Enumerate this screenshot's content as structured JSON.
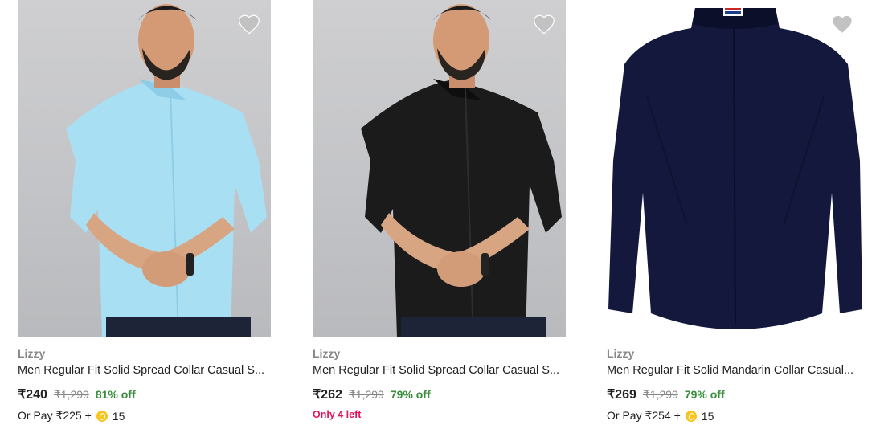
{
  "products": [
    {
      "brand": "Lizzy",
      "title": "Men Regular Fit Solid Spread Collar Casual S...",
      "price": "₹240",
      "mrp": "₹1,299",
      "discount": "81% off",
      "extra_prefix": "Or Pay ₹225 +",
      "extra_coins": "15",
      "shirt_color": "#a9dff3",
      "image_icon": "model-light-blue-shirt"
    },
    {
      "brand": "Lizzy",
      "title": "Men Regular Fit Solid Spread Collar Casual S...",
      "price": "₹262",
      "mrp": "₹1,299",
      "discount": "79% off",
      "stock_note": "Only 4 left",
      "shirt_color": "#1b1b1c",
      "image_icon": "model-black-shirt"
    },
    {
      "brand": "Lizzy",
      "title": "Men Regular Fit Solid Mandarin Collar Casual...",
      "price": "₹269",
      "mrp": "₹1,299",
      "discount": "79% off",
      "extra_prefix": "Or Pay ₹254 +",
      "extra_coins": "15",
      "shirt_color": "#13183c",
      "image_icon": "navy-mandarin-shirt"
    }
  ],
  "colors": {
    "discount_green": "#388e3c",
    "stock_pink": "#e4145a",
    "brand_grey": "#878787",
    "coin_gold": "#f9c51c",
    "wishlist_grey": "#c2c2c2"
  },
  "icons": {
    "wishlist": "heart-icon",
    "coin": "supercoin-icon"
  }
}
